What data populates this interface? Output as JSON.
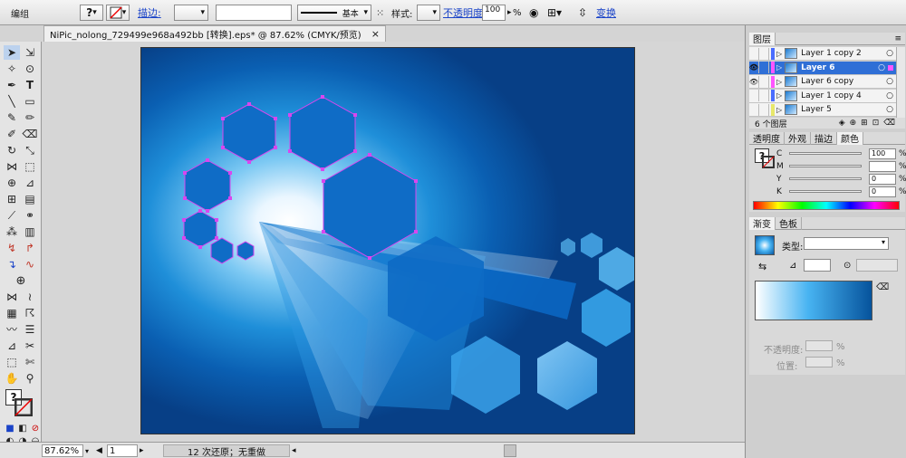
{
  "control_bar": {
    "group_label": "编组",
    "stroke_label": "描边:",
    "stroke_profile": "基本",
    "style_label": "样式:",
    "opacity_label": "不透明度:",
    "opacity_value": "100",
    "percent": "%",
    "transform_label": "变换"
  },
  "document_tab": {
    "title": "NiPic_nolong_729499e968a492bb [转换].eps* @ 87.62% (CMYK/预览)",
    "close": "×"
  },
  "status_bar": {
    "zoom": "87.62%",
    "artboard_number": "1",
    "status_text": "12 次还原；无重做"
  },
  "layers_panel": {
    "title": "图层",
    "layers": [
      {
        "name": "Layer 1 copy 2",
        "color": "#4a6cff",
        "visible": false,
        "selected": false
      },
      {
        "name": "Layer 6",
        "color": "#ff55ff",
        "visible": true,
        "selected": true
      },
      {
        "name": "Layer 6 copy",
        "color": "#ff55ff",
        "visible": true,
        "selected": false
      },
      {
        "name": "Layer 1 copy 4",
        "color": "#4a6cff",
        "visible": false,
        "selected": false
      },
      {
        "name": "Layer 5",
        "color": "#e8e86a",
        "visible": false,
        "selected": false
      }
    ],
    "count_label": "6 个图层"
  },
  "color_panel": {
    "tabs": [
      "透明度",
      "外观",
      "描边",
      "颜色"
    ],
    "active_tab": "颜色",
    "channels": [
      {
        "label": "C",
        "value": "100"
      },
      {
        "label": "M",
        "value": ""
      },
      {
        "label": "Y",
        "value": "0"
      },
      {
        "label": "K",
        "value": "0"
      }
    ],
    "percent": "%"
  },
  "gradient_panel": {
    "tabs": [
      "渐变",
      "色板"
    ],
    "active_tab": "渐变",
    "type_label": "类型:",
    "opacity_label": "不透明度:",
    "location_label": "位置:",
    "percent": "%"
  },
  "accent_colors": {
    "selection_blue": "#2f6fd6",
    "artboard_dark": "#073f86",
    "artboard_mid": "#1f8fd9",
    "path_highlight": "#d946ef"
  }
}
